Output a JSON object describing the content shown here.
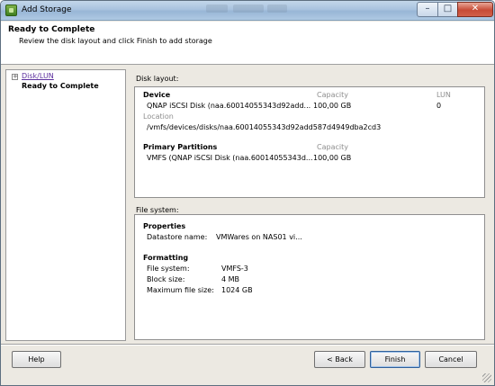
{
  "window": {
    "title": "Add Storage",
    "minimize_label": "–",
    "maximize_label": "□",
    "close_label": "✕"
  },
  "header": {
    "title": "Ready to Complete",
    "subtitle": "Review the disk layout and click Finish to add storage"
  },
  "nav": {
    "items": [
      {
        "label": "Disk/LUN",
        "expander": "+"
      },
      {
        "label": "Ready to Complete"
      }
    ]
  },
  "disk_layout": {
    "section_label": "Disk layout:",
    "device_heading": "Device",
    "capacity_heading": "Capacity",
    "lun_heading": "LUN",
    "device_name": "QNAP iSCSI Disk (naa.60014055343d92add...",
    "device_capacity": "100,00 GB",
    "device_lun": "0",
    "location_heading": "Location",
    "location_path": "/vmfs/devices/disks/naa.60014055343d92add587d4949dba2cd3",
    "partitions_heading": "Primary Partitions",
    "partitions_capacity_heading": "Capacity",
    "partition_name": "VMFS (QNAP iSCSI Disk (naa.60014055343d...",
    "partition_capacity": "100,00 GB"
  },
  "file_system": {
    "section_label": "File system:",
    "properties_heading": "Properties",
    "datastore_label": "Datastore name:",
    "datastore_value": "VMWares on NAS01 vi...",
    "formatting_heading": "Formatting",
    "fs_label": "File system:",
    "fs_value": "VMFS-3",
    "block_label": "Block size:",
    "block_value": "4 MB",
    "max_label": "Maximum file size:",
    "max_value": "1024 GB"
  },
  "footer": {
    "help_label": "Help",
    "back_label": "< Back",
    "finish_label": "Finish",
    "cancel_label": "Cancel"
  }
}
